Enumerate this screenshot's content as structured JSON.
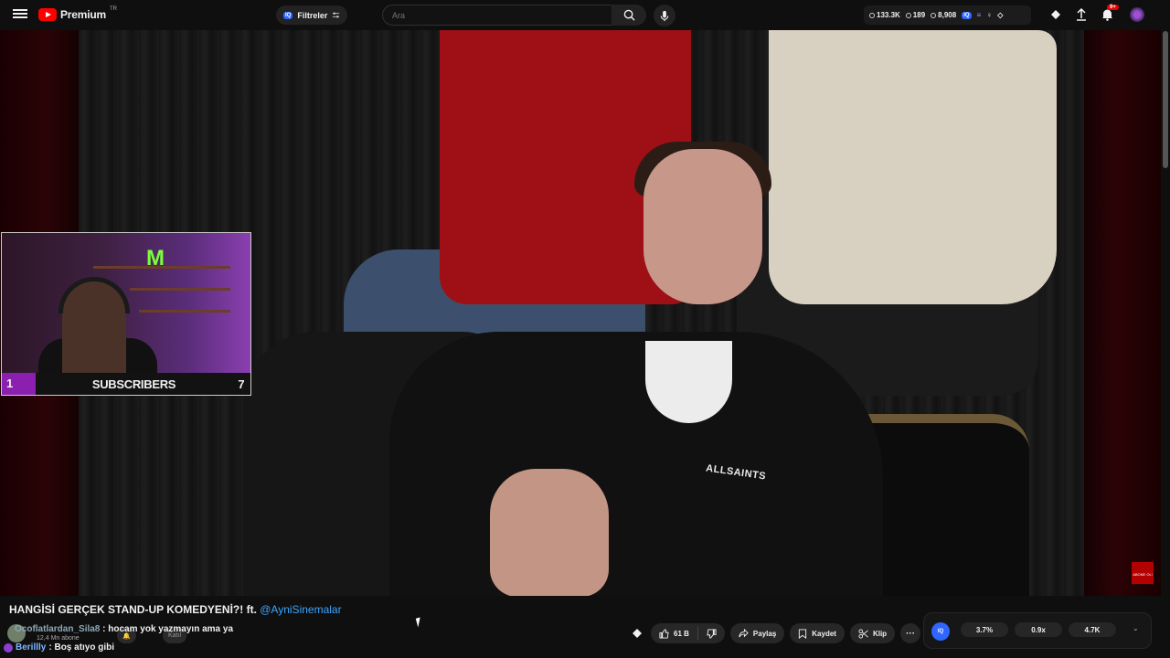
{
  "header": {
    "logo_text": "Premium",
    "logo_region": "TR",
    "filters_label": "Filtreler",
    "iq_badge": "IQ",
    "search_placeholder": "Ara",
    "stats": [
      {
        "icon": "clock-icon",
        "value": "133.3K"
      },
      {
        "icon": "eye-icon",
        "value": "189"
      },
      {
        "icon": "viewers-icon",
        "value": "8,908"
      }
    ],
    "notification_count": "9+"
  },
  "video": {
    "shirt_brand": "ALLSAINTS",
    "corner_badge": "ABONE OL!"
  },
  "webcam": {
    "left_value": "1",
    "label": "SUBSCRIBERS",
    "right_value": "7"
  },
  "below_video": {
    "title": "HANGİSİ GERÇEK STAND-UP KOMEDYENİ?! ft.",
    "title_link": "@AyniSinemalar",
    "channel_subs": "12,4 Mn abone",
    "faint_button": "Katıl"
  },
  "chat": [
    {
      "user": "Ocoflatlardan_Sila8",
      "message": ": hocam yok yazmayın ama ya"
    },
    {
      "user": "Berillly",
      "message": ": Boş atıyo gibi"
    }
  ],
  "actions": {
    "like_count": "61 B",
    "share_label": "Paylaş",
    "save_label": "Kaydet",
    "clip_label": "Klip"
  },
  "iq_panel": {
    "badge": "IQ",
    "values": [
      "3.7%",
      "0.9x",
      "4.7K"
    ]
  },
  "colors": {
    "accent_red": "#ff0000",
    "link_blue": "#3ea6ff",
    "iq_blue": "#2f66ff",
    "webcam_purple": "#8b1fb0"
  }
}
